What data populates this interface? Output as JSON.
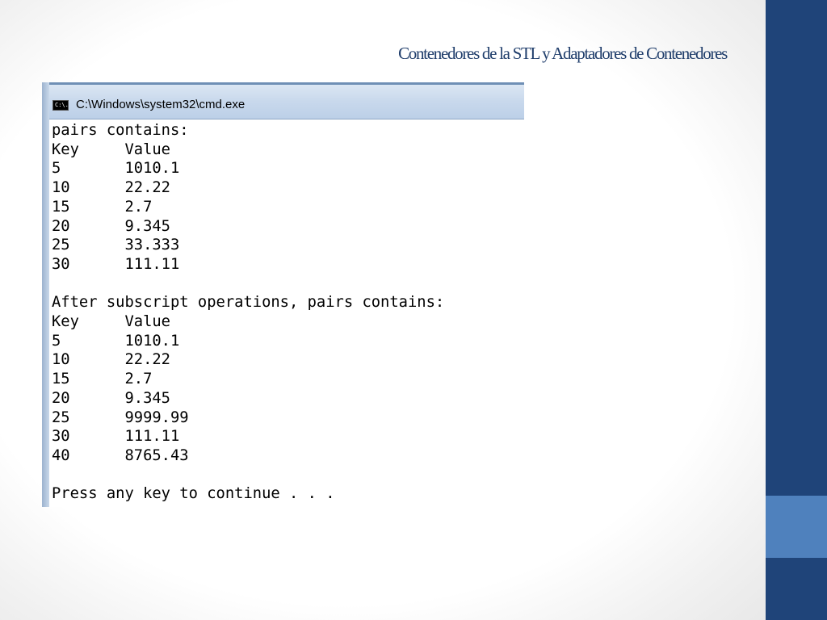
{
  "slide": {
    "title": "Contenedores de la STL y Adaptadores de Contenedores"
  },
  "window": {
    "icon": "cmd-icon",
    "icon_text": "C:\\.",
    "title": "C:\\Windows\\system32\\cmd.exe"
  },
  "console": {
    "lines": [
      "pairs contains:",
      "Key     Value",
      "5       1010.1",
      "10      22.22",
      "15      2.7",
      "20      9.345",
      "25      33.333",
      "30      111.11",
      "",
      "After subscript operations, pairs contains:",
      "Key     Value",
      "5       1010.1",
      "10      22.22",
      "15      2.7",
      "20      9.345",
      "25      9999.99",
      "30      111.11",
      "40      8765.43",
      "",
      "Press any key to continue . . ."
    ]
  },
  "colors": {
    "sidebar": "#1f4479",
    "sidebar_accent": "#4f81bd",
    "title_text": "#1f3d6b"
  }
}
